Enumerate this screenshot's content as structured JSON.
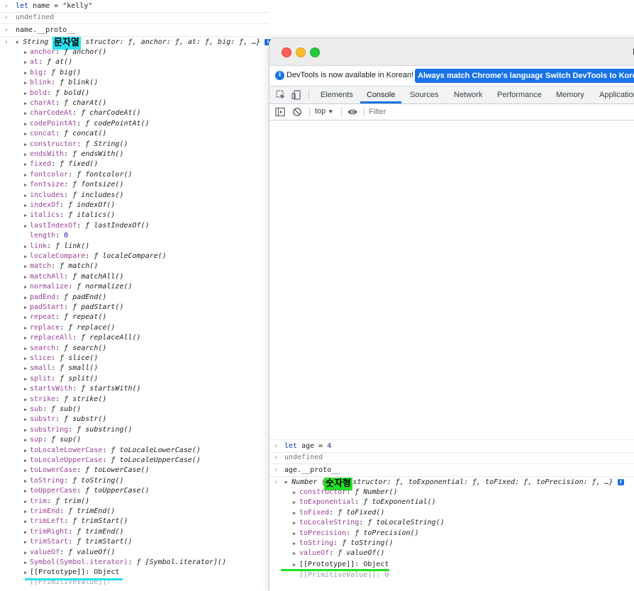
{
  "left_console": {
    "input1": "let name = \"kelly\"",
    "output1": "undefined",
    "input2": "name.__proto__",
    "summary_prefix": "String {",
    "summary_rest": "structor: ƒ, anchor: ƒ, at: ƒ, big: ƒ, …}",
    "label": "문자열",
    "properties": [
      {
        "key": "anchor",
        "val": "ƒ anchor()"
      },
      {
        "key": "at",
        "val": "ƒ at()"
      },
      {
        "key": "big",
        "val": "ƒ big()"
      },
      {
        "key": "blink",
        "val": "ƒ blink()"
      },
      {
        "key": "bold",
        "val": "ƒ bold()"
      },
      {
        "key": "charAt",
        "val": "ƒ charAt()"
      },
      {
        "key": "charCodeAt",
        "val": "ƒ charCodeAt()"
      },
      {
        "key": "codePointAt",
        "val": "ƒ codePointAt()"
      },
      {
        "key": "concat",
        "val": "ƒ concat()"
      },
      {
        "key": "constructor",
        "val": "ƒ String()"
      },
      {
        "key": "endsWith",
        "val": "ƒ endsWith()"
      },
      {
        "key": "fixed",
        "val": "ƒ fixed()"
      },
      {
        "key": "fontcolor",
        "val": "ƒ fontcolor()"
      },
      {
        "key": "fontsize",
        "val": "ƒ fontsize()"
      },
      {
        "key": "includes",
        "val": "ƒ includes()"
      },
      {
        "key": "indexOf",
        "val": "ƒ indexOf()"
      },
      {
        "key": "italics",
        "val": "ƒ italics()"
      },
      {
        "key": "lastIndexOf",
        "val": "ƒ lastIndexOf()"
      },
      {
        "key": "length",
        "val": "0",
        "plain": true
      },
      {
        "key": "link",
        "val": "ƒ link()"
      },
      {
        "key": "localeCompare",
        "val": "ƒ localeCompare()"
      },
      {
        "key": "match",
        "val": "ƒ match()"
      },
      {
        "key": "matchAll",
        "val": "ƒ matchAll()"
      },
      {
        "key": "normalize",
        "val": "ƒ normalize()"
      },
      {
        "key": "padEnd",
        "val": "ƒ padEnd()"
      },
      {
        "key": "padStart",
        "val": "ƒ padStart()"
      },
      {
        "key": "repeat",
        "val": "ƒ repeat()"
      },
      {
        "key": "replace",
        "val": "ƒ replace()"
      },
      {
        "key": "replaceAll",
        "val": "ƒ replaceAll()"
      },
      {
        "key": "search",
        "val": "ƒ search()"
      },
      {
        "key": "slice",
        "val": "ƒ slice()"
      },
      {
        "key": "small",
        "val": "ƒ small()"
      },
      {
        "key": "split",
        "val": "ƒ split()"
      },
      {
        "key": "startsWith",
        "val": "ƒ startsWith()"
      },
      {
        "key": "strike",
        "val": "ƒ strike()"
      },
      {
        "key": "sub",
        "val": "ƒ sub()"
      },
      {
        "key": "substr",
        "val": "ƒ substr()"
      },
      {
        "key": "substring",
        "val": "ƒ substring()"
      },
      {
        "key": "sup",
        "val": "ƒ sup()"
      },
      {
        "key": "toLocaleLowerCase",
        "val": "ƒ toLocaleLowerCase()"
      },
      {
        "key": "toLocaleUpperCase",
        "val": "ƒ toLocaleUpperCase()"
      },
      {
        "key": "toLowerCase",
        "val": "ƒ toLowerCase()"
      },
      {
        "key": "toString",
        "val": "ƒ toString()"
      },
      {
        "key": "toUpperCase",
        "val": "ƒ toUpperCase()"
      },
      {
        "key": "trim",
        "val": "ƒ trim()"
      },
      {
        "key": "trimEnd",
        "val": "ƒ trimEnd()"
      },
      {
        "key": "trimLeft",
        "val": "ƒ trimStart()"
      },
      {
        "key": "trimRight",
        "val": "ƒ trimEnd()"
      },
      {
        "key": "trimStart",
        "val": "ƒ trimStart()"
      },
      {
        "key": "valueOf",
        "val": "ƒ valueOf()"
      },
      {
        "key": "Symbol(Symbol.iterator)",
        "val": "ƒ [Symbol.iterator]()"
      }
    ],
    "prototype_row": "[[Prototype]]: Object",
    "cut_row": "[[PrimitiveValue]]: \"\""
  },
  "devtools": {
    "infobar": {
      "message": "DevTools is now available in Korean!",
      "btn_match": "Always match Chrome's language",
      "btn_switch": "Switch DevTools to Korean"
    },
    "tabs": [
      "Elements",
      "Console",
      "Sources",
      "Network",
      "Performance",
      "Memory",
      "Application"
    ],
    "context": "top",
    "filter_placeholder": "Filter",
    "console": {
      "input1_kw": "let",
      "input1_rest": " age = ",
      "input1_num": "4",
      "output1": "undefined",
      "input2": "age.__proto__",
      "summary_prefix": "Number {",
      "summary_rest": "structor: ƒ, toExponential: ƒ, toFixed: ƒ, toPrecision: ƒ, …}",
      "label": "숫자형",
      "properties": [
        {
          "key": "constructor",
          "val": "ƒ Number()"
        },
        {
          "key": "toExponential",
          "val": "ƒ toExponential()"
        },
        {
          "key": "toFixed",
          "val": "ƒ toFixed()"
        },
        {
          "key": "toLocaleString",
          "val": "ƒ toLocaleString()"
        },
        {
          "key": "toPrecision",
          "val": "ƒ toPrecision()"
        },
        {
          "key": "toString",
          "val": "ƒ toString()"
        },
        {
          "key": "valueOf",
          "val": "ƒ valueOf()"
        }
      ],
      "prototype_row": "[[Prototype]]: Object",
      "cut_row": "[[PrimitiveValue]]: 0"
    }
  },
  "colors": {
    "string_label_bg": "#26e0f0",
    "number_label_bg": "#22e022",
    "accent_blue": "#1a73e8",
    "prop_key": "#9b3e96"
  }
}
